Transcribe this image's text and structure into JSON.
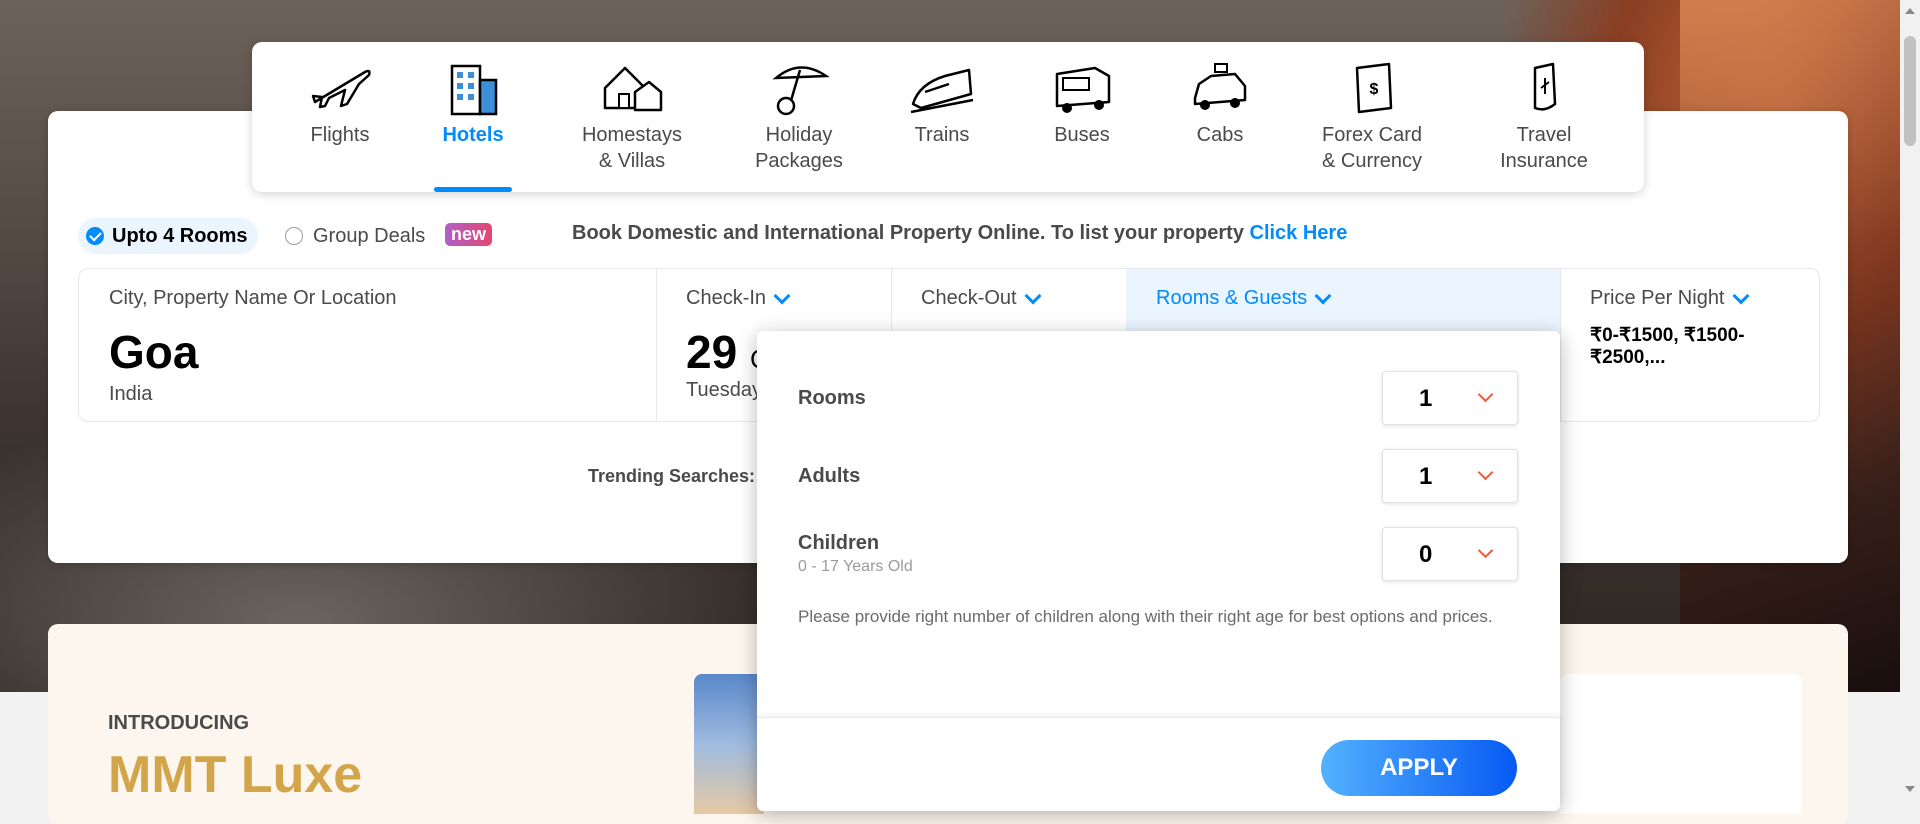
{
  "nav": {
    "items": [
      {
        "label": "Flights",
        "icon": "airplane-icon"
      },
      {
        "label": "Hotels",
        "icon": "hotel-building-icon",
        "active": true
      },
      {
        "label": "Homestays\n& Villas",
        "icon": "house-icon"
      },
      {
        "label": "Holiday\nPackages",
        "icon": "umbrella-icon"
      },
      {
        "label": "Trains",
        "icon": "train-icon"
      },
      {
        "label": "Buses",
        "icon": "bus-icon"
      },
      {
        "label": "Cabs",
        "icon": "cab-icon"
      },
      {
        "label": "Forex Card\n& Currency",
        "icon": "forex-card-icon"
      },
      {
        "label": "Travel\nInsurance",
        "icon": "insurance-shield-icon"
      }
    ]
  },
  "options": {
    "rooms_label": "Upto 4 Rooms",
    "group_label": "Group Deals",
    "new_badge": "new",
    "promo_text": "Book Domestic and International Property Online. To list your property ",
    "promo_link": "Click Here"
  },
  "search": {
    "city_label": "City, Property Name Or Location",
    "city_value": "Goa",
    "city_sub": "India",
    "checkin_label": "Check-In",
    "checkin_day": "29",
    "checkin_month_partial": "C",
    "checkin_sub": "Tuesday",
    "checkout_label": "Check-Out",
    "guests_label": "Rooms & Guests",
    "price_label": "Price Per Night",
    "price_value": "₹0-₹1500, ₹1500-₹2500,..."
  },
  "trending_label": "Trending Searches:",
  "guests_dropdown": {
    "rooms_label": "Rooms",
    "rooms_value": "1",
    "adults_label": "Adults",
    "adults_value": "1",
    "children_label": "Children",
    "children_sub": "0 - 17 Years Old",
    "children_value": "0",
    "note": "Please provide right number of children along with their right age for best options and prices.",
    "apply_label": "APPLY"
  },
  "luxe": {
    "intro": "INTRODUCING",
    "title": "MMT Luxe"
  },
  "colors": {
    "accent": "#008cff",
    "chevron": "#eb5b3c",
    "luxe_gold": "#d3a54a"
  }
}
